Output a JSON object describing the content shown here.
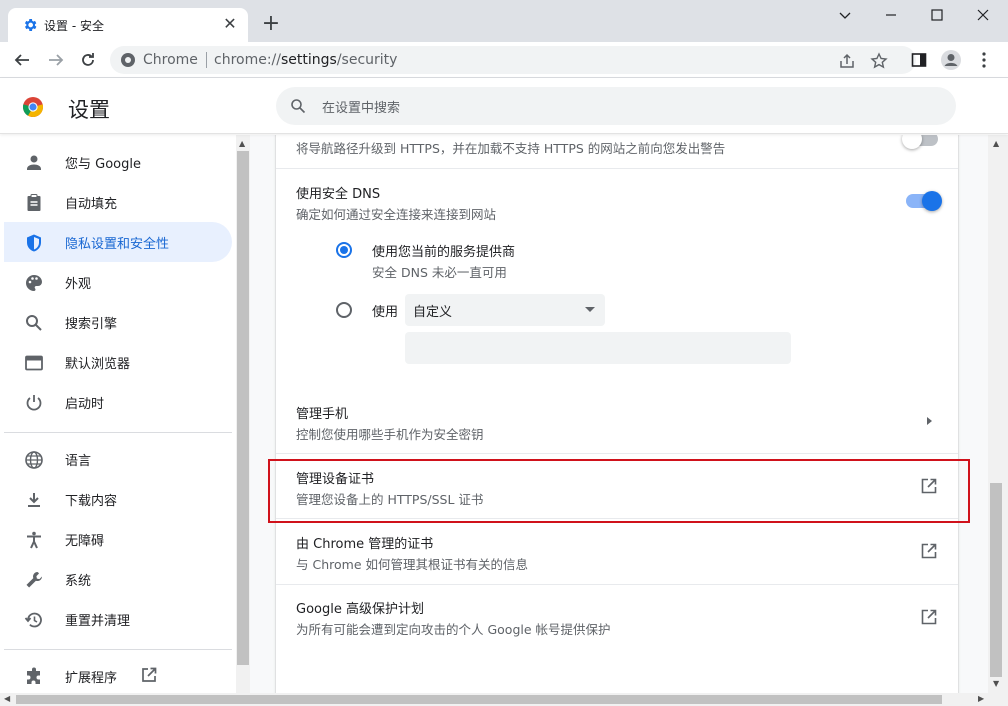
{
  "tab": {
    "title": "设置 - 安全",
    "close": "✕"
  },
  "newtab": "+",
  "window": {
    "minimize": "—",
    "maximize": "☐",
    "close": "✕"
  },
  "omnibox": {
    "site": "Chrome",
    "url_prefix": "chrome://",
    "url_host": "settings",
    "url_path": "/security"
  },
  "header": {
    "title": "设置",
    "search_placeholder": "在设置中搜索"
  },
  "sidebar": {
    "items": [
      {
        "label": "您与 Google",
        "icon": "person-icon"
      },
      {
        "label": "自动填充",
        "icon": "clipboard-icon"
      },
      {
        "label": "隐私设置和安全性",
        "icon": "shield-icon",
        "active": true
      },
      {
        "label": "外观",
        "icon": "palette-icon"
      },
      {
        "label": "搜索引擎",
        "icon": "search-icon"
      },
      {
        "label": "默认浏览器",
        "icon": "browser-icon"
      },
      {
        "label": "启动时",
        "icon": "power-icon"
      },
      {
        "label": "语言",
        "icon": "globe-icon"
      },
      {
        "label": "下载内容",
        "icon": "download-icon"
      },
      {
        "label": "无障碍",
        "icon": "accessibility-icon"
      },
      {
        "label": "系统",
        "icon": "wrench-icon"
      },
      {
        "label": "重置并清理",
        "icon": "history-icon"
      },
      {
        "label": "扩展程序",
        "icon": "puzzle-icon"
      }
    ]
  },
  "content": {
    "https_desc": "将导航路径升级到 HTTPS，并在加载不支持 HTTPS 的网站之前向您发出警告",
    "https_toggle": false,
    "dns": {
      "title": "使用安全 DNS",
      "desc": "确定如何通过安全连接来连接到网站",
      "toggle": true,
      "option1_title": "使用您当前的服务提供商",
      "option1_desc": "安全 DNS 未必一直可用",
      "option1_checked": true,
      "option2_label": "使用",
      "option2_select": "自定义",
      "option2_checked": false
    },
    "phones": {
      "title": "管理手机",
      "desc": "控制您使用哪些手机作为安全密钥"
    },
    "device_certs": {
      "title": "管理设备证书",
      "desc": "管理您设备上的 HTTPS/SSL 证书"
    },
    "chrome_certs": {
      "title": "由 Chrome 管理的证书",
      "desc": "与 Chrome 如何管理其根证书有关的信息"
    },
    "advanced": {
      "title": "Google 高级保护计划",
      "desc": "为所有可能会遭到定向攻击的个人 Google 帐号提供保护"
    }
  },
  "colors": {
    "accent": "#1a73e8",
    "highlight_border": "#d0121b",
    "active_nav_bg": "#e8f0fe"
  }
}
